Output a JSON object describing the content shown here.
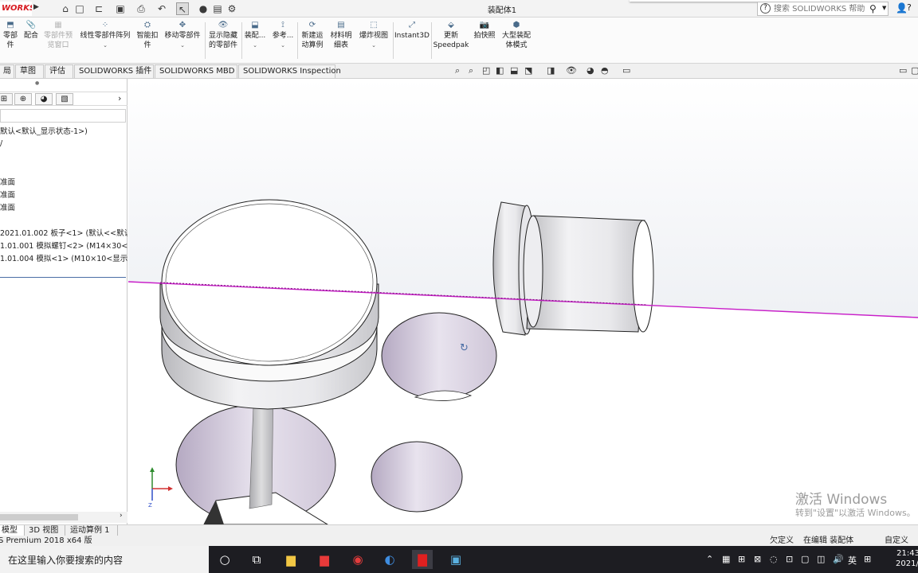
{
  "titlebar": {
    "logo": "WORKS",
    "document_title": "装配体1",
    "search_placeholder": "搜索 SOLIDWORKS 帮助",
    "accent": "#d71920"
  },
  "commands": [
    {
      "label": "零部件",
      "sub": ""
    },
    {
      "label": "配合",
      "sub": ""
    },
    {
      "label": "零部件预",
      "sub": "览窗口"
    },
    {
      "label": "线性零部件阵列",
      "sub": ""
    },
    {
      "label": "智能扣",
      "sub": "件"
    },
    {
      "label": "移动零部件",
      "sub": ""
    },
    {
      "label": "显示隐藏",
      "sub": "的零部件"
    },
    {
      "label": "装配...",
      "sub": ""
    },
    {
      "label": "参考...",
      "sub": ""
    },
    {
      "label": "新建运",
      "sub": "动算例"
    },
    {
      "label": "材料明",
      "sub": "细表"
    },
    {
      "label": "爆炸视图",
      "sub": ""
    },
    {
      "label": "Instant3D",
      "sub": ""
    },
    {
      "label": "更新",
      "sub": "Speedpak"
    },
    {
      "label": "拍快照",
      "sub": ""
    },
    {
      "label": "大型装配",
      "sub": "体模式"
    }
  ],
  "tabs": [
    "局",
    "草图",
    "评估",
    "SOLIDWORKS 插件",
    "SOLIDWORKS MBD",
    "SOLIDWORKS Inspection"
  ],
  "tree": [
    "默认<默认_显示状态-1>)",
    "/",
    "准面",
    "准面",
    "准面",
    "2021.01.002 板子<1> (默认<<默认",
    "1.01.001 模拟螺钉<2> (M14×30<",
    "1.01.004 模拟<1> (M10×10<显示"
  ],
  "model_tabs": [
    "模型",
    "3D 视图",
    "运动算例 1"
  ],
  "status": {
    "product": "S Premium 2018 x64 版",
    "defined": "欠定义",
    "editing": "在编辑 装配体",
    "custom": "自定义"
  },
  "taskbar": {
    "search_text": "在这里输入你要搜索的内容",
    "ime": "英",
    "time": "21:43",
    "date": "2021/2"
  },
  "watermark": {
    "title": "激活 Windows",
    "subtitle": "转到\"设置\"以激活 Windows。"
  },
  "icons": {
    "qa": [
      "home-icon",
      "new-doc-icon",
      "open-icon",
      "save-icon",
      "print-icon",
      "undo-icon",
      "select-icon",
      "rebuild-icon",
      "file-props-icon",
      "options-icon"
    ],
    "panel_tabs": [
      "feature-manager-icon",
      "property-manager-icon",
      "configuration-manager-icon",
      "dimxpert-icon",
      "display-manager-icon"
    ]
  }
}
